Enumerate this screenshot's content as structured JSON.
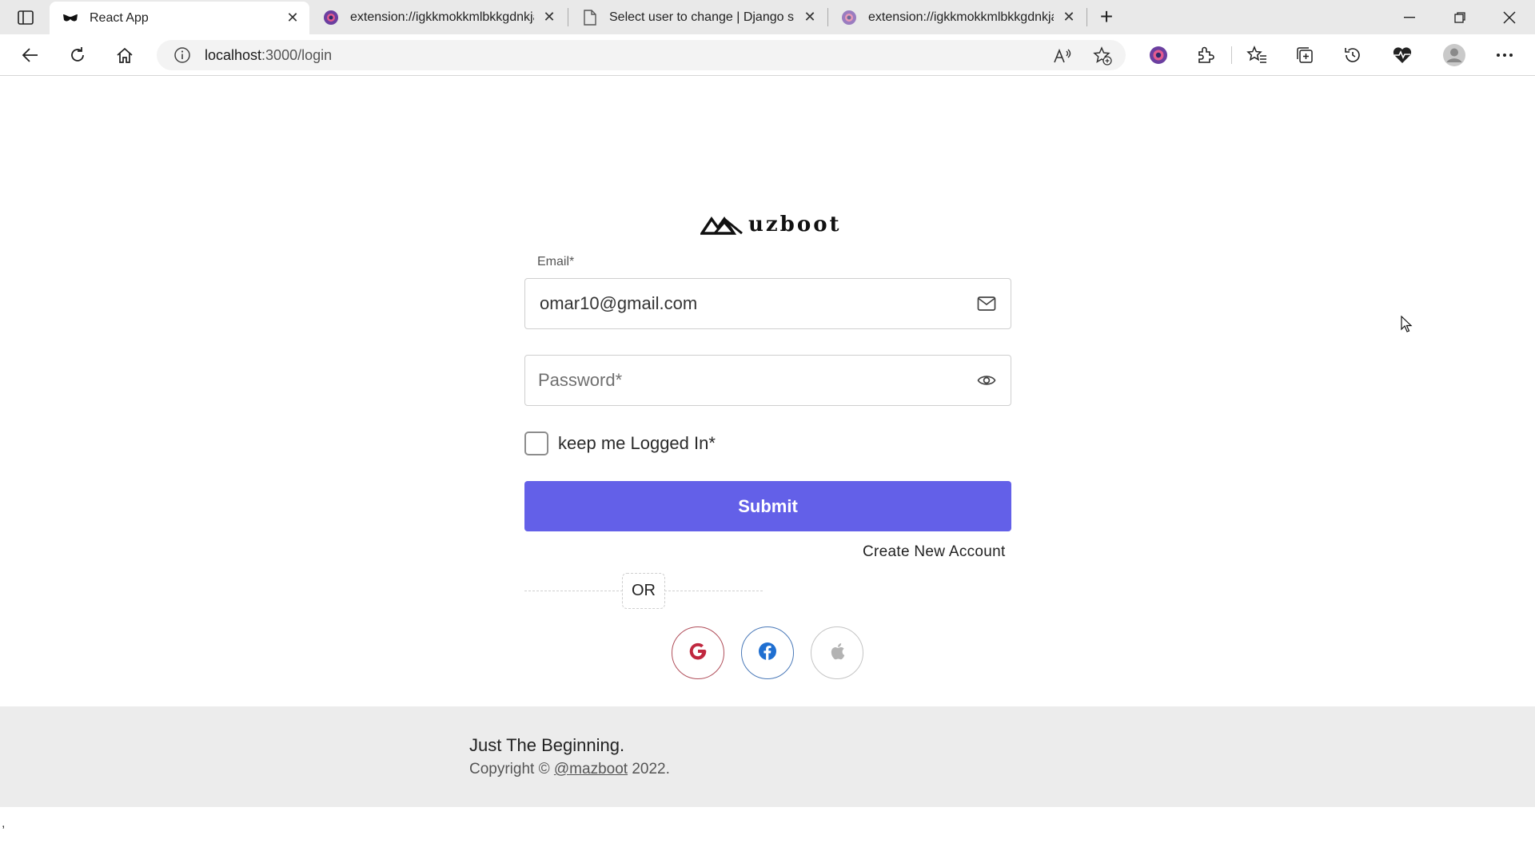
{
  "browser": {
    "tabs": [
      {
        "title": "React App",
        "favicon": "mask-icon",
        "active": true
      },
      {
        "title": "extension://igkkmokkmlbkkgdnkjancbl",
        "favicon": "extension-icon",
        "active": false
      },
      {
        "title": "Select user to change | Django site admin",
        "favicon": "page-icon",
        "active": false
      },
      {
        "title": "extension://igkkmokkmlbkkgdnkjancbl",
        "favicon": "extension-icon",
        "active": false
      }
    ],
    "new_tab_label": "+",
    "address": {
      "host": "localhost",
      "path": ":3000/login"
    }
  },
  "login": {
    "brand": "uzboot",
    "email_label": "Email*",
    "email_value": "omar10@gmail.com",
    "password_placeholder": "Password*",
    "remember_label": "keep me Logged In*",
    "remember_checked": false,
    "submit_label": "Submit",
    "create_account_label": "Create New Account",
    "or_label": "OR",
    "social": [
      "google-icon",
      "facebook-icon",
      "apple-icon"
    ],
    "accent_color": "#6360e8"
  },
  "footer": {
    "title": "Just The Beginning.",
    "copy_prefix": "Copyright ©",
    "copy_link": "@mazboot",
    "copy_suffix": "2022."
  },
  "stray_text": ","
}
